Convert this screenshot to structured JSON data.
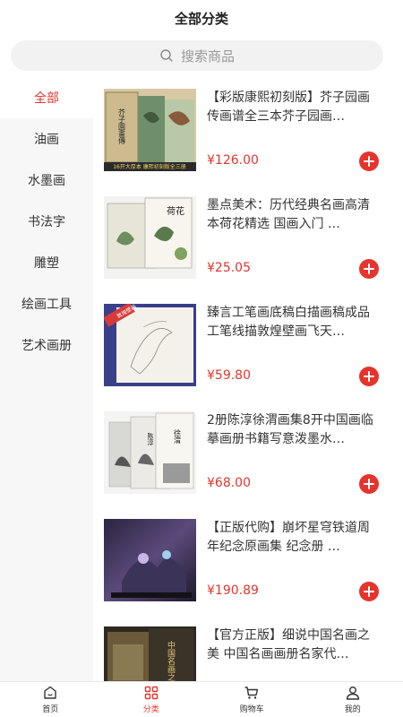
{
  "header": {
    "title": "全部分类"
  },
  "search": {
    "placeholder": "搜索商品"
  },
  "sidebar": {
    "items": [
      {
        "label": "全部",
        "active": true
      },
      {
        "label": "油画"
      },
      {
        "label": "水墨画"
      },
      {
        "label": "书法字"
      },
      {
        "label": "雕塑"
      },
      {
        "label": "绘画工具"
      },
      {
        "label": "艺术画册"
      }
    ]
  },
  "products": [
    {
      "name": "【彩版康熙初刻版】芥子园画传画谱全三本芥子园画…",
      "price": "¥126.00",
      "cover_text_1": "芥子園畫傳",
      "cover_text_2": "16开大厚本 康熙初刻版全三册"
    },
    {
      "name": "墨点美术：历代经典名画高清本荷花精选 国画入门 …",
      "price": "¥25.05",
      "cover_text_1": "荷花"
    },
    {
      "name": "臻言工笔画底稿白描画稿成品工笔线描敦煌壁画飞天…",
      "price": "¥59.80",
      "cover_text_1": "敦煌壁画"
    },
    {
      "name": "2册陈淳徐渭画集8开中国画临摹画册书籍写意泼墨水…",
      "price": "¥68.00",
      "cover_text_1": "徐渭",
      "cover_text_2": "陈淳"
    },
    {
      "name": "【正版代购】崩坏星穹铁道周年纪念原画集 纪念册 …",
      "price": "¥190.89"
    },
    {
      "name": "【官方正版】细说中国名画之美 中国名画画册名家代…",
      "price": "",
      "cover_text_1": "中国名画之美"
    }
  ],
  "tabbar": {
    "items": [
      {
        "label": "首页",
        "icon": "home-icon"
      },
      {
        "label": "分类",
        "icon": "category-icon",
        "active": true
      },
      {
        "label": "购物车",
        "icon": "cart-icon"
      },
      {
        "label": "我的",
        "icon": "user-icon"
      }
    ]
  },
  "colors": {
    "accent": "#e5342d",
    "sidebar_bg": "#f7f7f7",
    "search_bg": "#f2f2f2"
  }
}
